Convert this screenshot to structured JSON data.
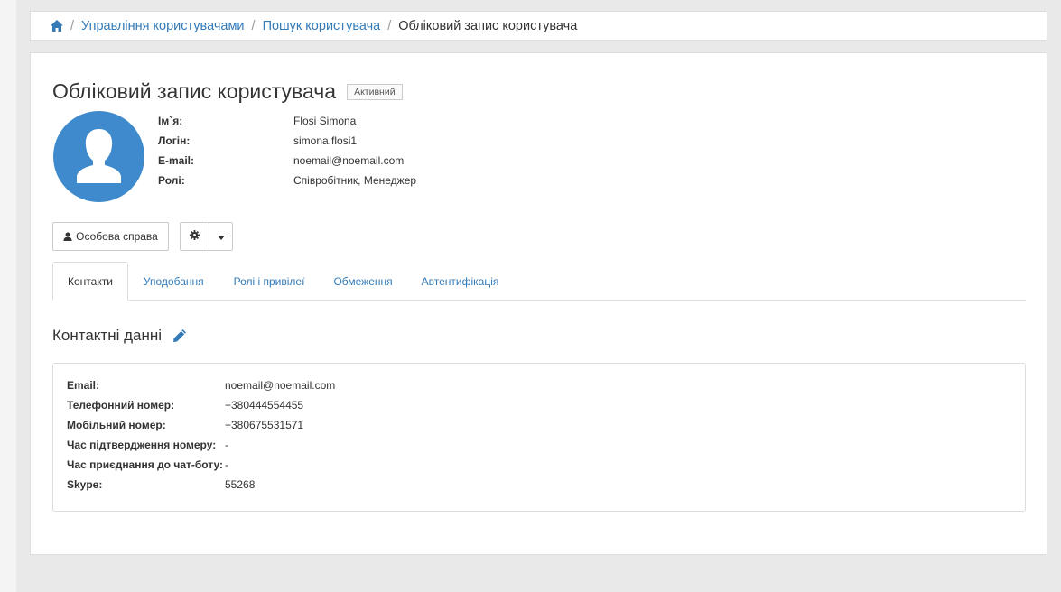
{
  "breadcrumb": {
    "home_icon": "home-icon",
    "items": [
      "Управління користувачами",
      "Пошук користувача"
    ],
    "current": "Обліковий запис користувача",
    "separator": "/"
  },
  "header": {
    "title": "Обліковий запис користувача",
    "status": "Активний"
  },
  "user": {
    "avatar_icon": "user-avatar-icon",
    "rows": [
      {
        "label": "Ім`я:",
        "value": "Flosi Simona"
      },
      {
        "label": "Логін:",
        "value": "simona.flosi1"
      },
      {
        "label": "E-mail:",
        "value": "noemail@noemail.com"
      },
      {
        "label": "Ролі:",
        "value": "Співробітник, Менеджер"
      }
    ]
  },
  "actions": {
    "dossier_label": "Особова справа",
    "settings_icon": "gear-icon",
    "dropdown_icon": "caret-down-icon"
  },
  "tabs": [
    {
      "label": "Контакти",
      "active": true
    },
    {
      "label": "Уподобання",
      "active": false
    },
    {
      "label": "Ролі і привілеї",
      "active": false
    },
    {
      "label": "Обмеження",
      "active": false
    },
    {
      "label": "Автентифікація",
      "active": false
    }
  ],
  "contacts": {
    "title": "Контактні данні",
    "edit_icon": "pencil-icon",
    "rows": [
      {
        "label": "Email:",
        "value": "noemail@noemail.com"
      },
      {
        "label": "Телефонний номер:",
        "value": "+380444554455"
      },
      {
        "label": "Мобільний номер:",
        "value": "+380675531571"
      },
      {
        "label": "Час підтвердження номеру:",
        "value": "-"
      },
      {
        "label": "Час приєднання до чат-боту:",
        "value": "-"
      },
      {
        "label": "Skype:",
        "value": "55268"
      }
    ]
  },
  "colors": {
    "link": "#337ab7",
    "avatar_bg": "#3e8acc"
  }
}
